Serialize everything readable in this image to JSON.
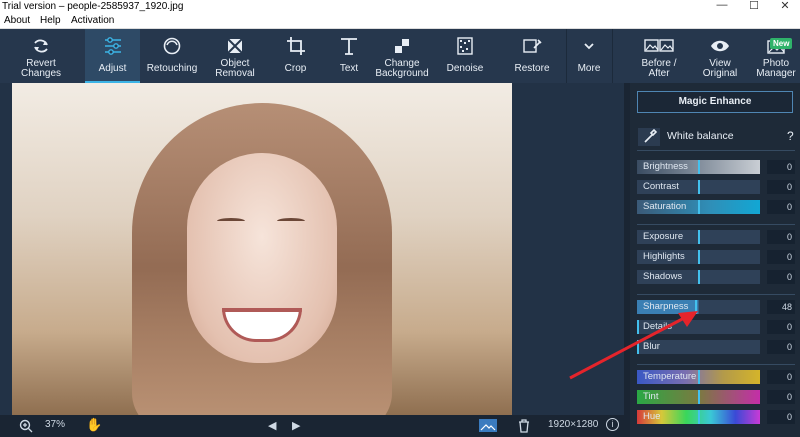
{
  "window": {
    "title": "Trial version – people-2585937_1920.jpg"
  },
  "menu": {
    "items": [
      "About",
      "Help",
      "Activation"
    ]
  },
  "toolbar": {
    "tools": [
      {
        "line1": "Revert",
        "line2": "Changes",
        "icon": "revert-icon"
      },
      {
        "line1": "Adjust",
        "line2": "",
        "icon": "sliders-icon",
        "active": true
      },
      {
        "line1": "Retouching",
        "line2": "",
        "icon": "face-icon"
      },
      {
        "line1": "Object",
        "line2": "Removal",
        "icon": "eraser-icon"
      },
      {
        "line1": "Crop",
        "line2": "",
        "icon": "crop-icon"
      },
      {
        "line1": "Text",
        "line2": "",
        "icon": "text-icon"
      },
      {
        "line1": "Change",
        "line2": "Background",
        "icon": "background-icon"
      },
      {
        "line1": "Denoise",
        "line2": "",
        "icon": "denoise-icon"
      },
      {
        "line1": "Restore",
        "line2": "",
        "icon": "restore-icon"
      },
      {
        "line1": "More",
        "line2": "",
        "icon": "chevron-down-icon"
      },
      {
        "line1": "Before /",
        "line2": "After",
        "icon": "before-after-icon"
      },
      {
        "line1": "View",
        "line2": "Original",
        "icon": "eye-icon"
      },
      {
        "line1": "Photo",
        "line2": "Manager",
        "icon": "photo-manager-icon"
      }
    ],
    "new_badge": "New"
  },
  "panel": {
    "magic_enhance": "Magic Enhance",
    "white_balance": "White balance",
    "help": "?",
    "groups": [
      [
        {
          "label": "Brightness",
          "value": "0",
          "level": 0.5,
          "style": "grad-gray"
        },
        {
          "label": "Contrast",
          "value": "0",
          "level": 0.5,
          "style": "plain"
        },
        {
          "label": "Saturation",
          "value": "0",
          "level": 0.5,
          "style": "grad-blue"
        }
      ],
      [
        {
          "label": "Exposure",
          "value": "0",
          "level": 0.5,
          "style": "plain"
        },
        {
          "label": "Highlights",
          "value": "0",
          "level": 0.5,
          "style": "plain"
        },
        {
          "label": "Shadows",
          "value": "0",
          "level": 0.5,
          "style": "plain"
        }
      ],
      [
        {
          "label": "Sharpness",
          "value": "48",
          "level": 0.48,
          "style": "filled"
        },
        {
          "label": "Details",
          "value": "0",
          "level": 0.0,
          "style": "plain"
        },
        {
          "label": "Blur",
          "value": "0",
          "level": 0.0,
          "style": "plain"
        }
      ],
      [
        {
          "label": "Temperature",
          "value": "0",
          "level": 0.5,
          "style": "grad-temp"
        },
        {
          "label": "Tint",
          "value": "0",
          "level": 0.5,
          "style": "grad-tint"
        },
        {
          "label": "Hue",
          "value": "0",
          "level": 0.5,
          "style": "grad-hue"
        }
      ]
    ]
  },
  "status": {
    "zoom": "37%",
    "dimensions": "1920×1280",
    "info": "i"
  },
  "colors": {
    "accent": "#3cb4e6",
    "toolbar": "#26374d",
    "panel": "#1e2a38",
    "annotation": "#e5242b"
  }
}
